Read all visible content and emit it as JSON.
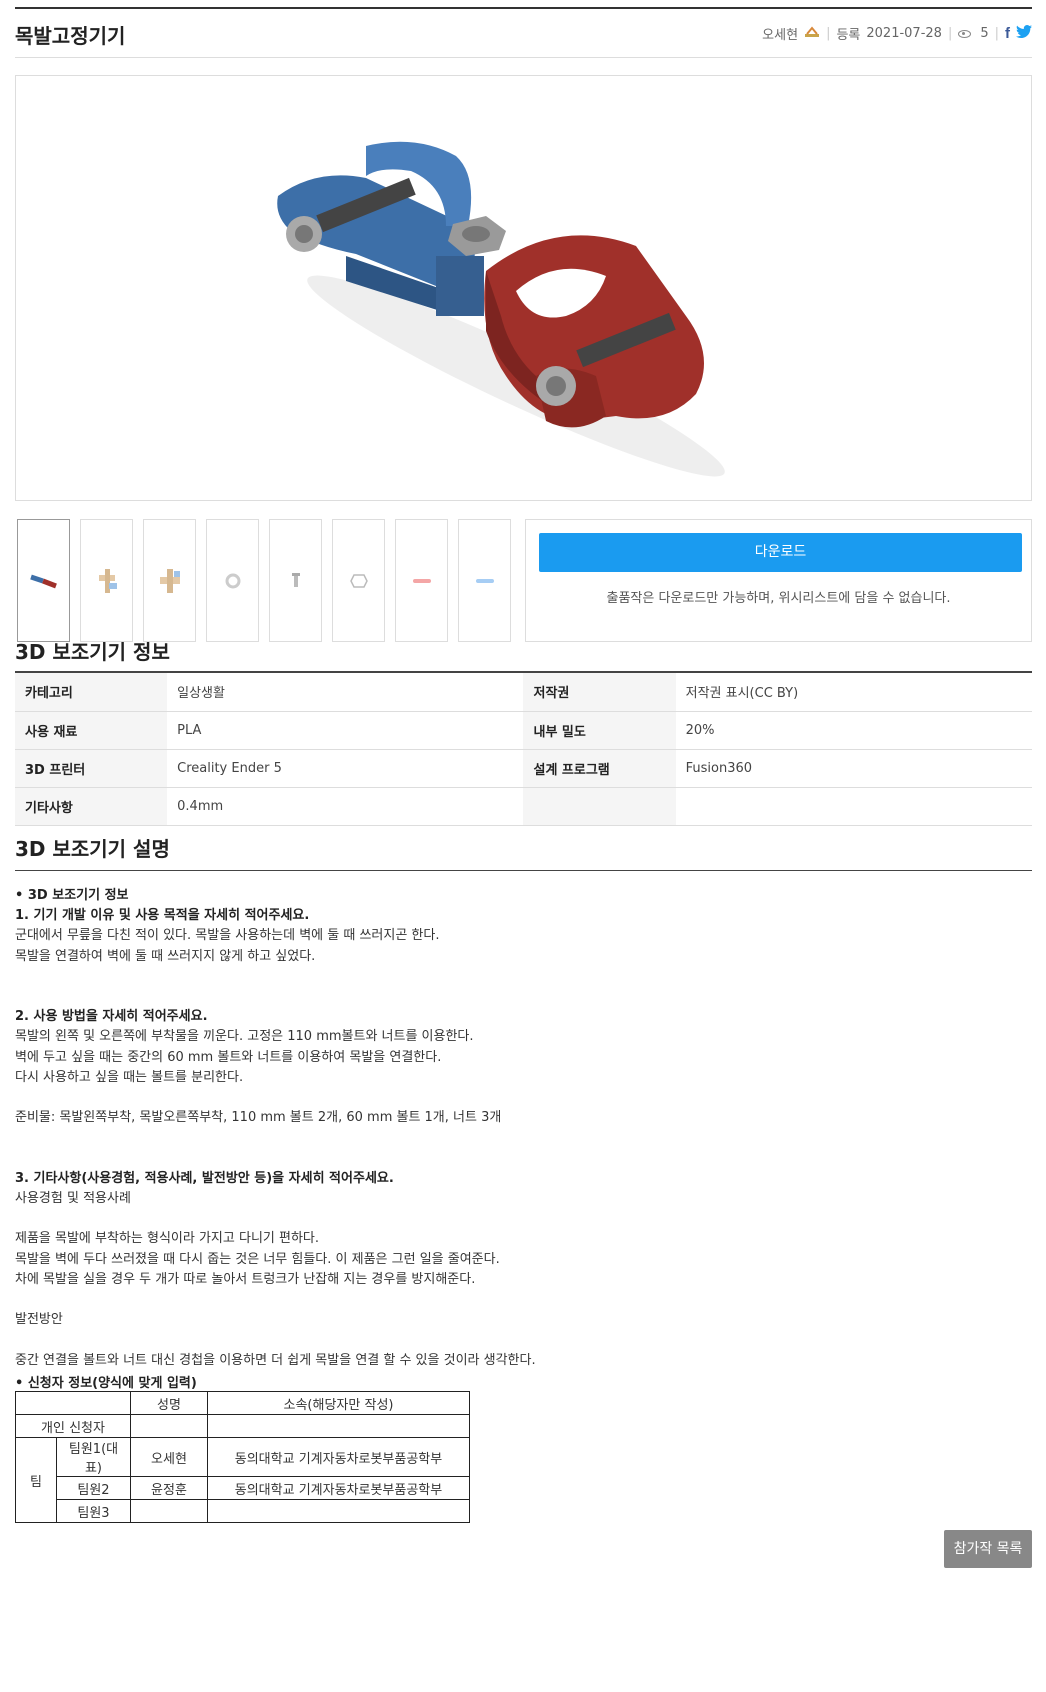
{
  "header": {
    "title": "목발고정기기",
    "author": "오세현",
    "registered_label": "등록",
    "registered_date": "2021-07-28",
    "views": "5",
    "facebook": "f"
  },
  "thumbnails": [
    "model-full",
    "model-part-a",
    "model-part-b",
    "washer",
    "bolt",
    "nut",
    "pink-part",
    "blue-part"
  ],
  "download": {
    "button_label": "다운로드",
    "note": "출품작은 다운로드만 가능하며, 위시리스트에 담을 수 없습니다."
  },
  "info": {
    "title": "3D 보조기기 정보",
    "rows": [
      {
        "k1": "카테고리",
        "v1": "일상생활",
        "k2": "저작권",
        "v2": "저작권 표시(CC BY)"
      },
      {
        "k1": "사용 재료",
        "v1": "PLA",
        "k2": "내부 밀도",
        "v2": "20%"
      },
      {
        "k1": "3D 프린터",
        "v1": "Creality Ender 5",
        "k2": "설계 프로그램",
        "v2": "Fusion360"
      },
      {
        "k1": "기타사항",
        "v1": "0.4mm",
        "k2": "",
        "v2": ""
      }
    ]
  },
  "description": {
    "title": "3D 보조기기 설명",
    "lines": [
      {
        "t": "• 3D 보조기기 정보",
        "b": true
      },
      {
        "t": "1. 기기 개발 이유 및 사용 목적을 자세히 적어주세요.",
        "b": true
      },
      {
        "t": "군대에서 무릎을 다친 적이 있다. 목발을 사용하는데 벽에 둘 때 쓰러지곤 한다.",
        "b": false
      },
      {
        "t": "목발을 연결하여 벽에 둘 때 쓰러지지 않게 하고 싶었다.",
        "b": false
      },
      {
        "t": "",
        "b": false
      },
      {
        "t": "",
        "b": false
      },
      {
        "t": "2. 사용 방법을 자세히 적어주세요.",
        "b": true
      },
      {
        "t": "목발의 왼쪽 및 오른쪽에 부착물을 끼운다. 고정은 110 mm볼트와 너트를 이용한다.",
        "b": false
      },
      {
        "t": "벽에 두고 싶을 때는 중간의 60 mm 볼트와 너트를 이용하여 목발을 연결한다.",
        "b": false
      },
      {
        "t": "다시 사용하고 싶을 때는 볼트를 분리한다.",
        "b": false
      },
      {
        "t": "",
        "b": false
      },
      {
        "t": "준비물: 목발왼쪽부착, 목발오른쪽부착, 110 mm 볼트 2개, 60 mm 볼트 1개, 너트 3개",
        "b": false
      },
      {
        "t": "",
        "b": false
      },
      {
        "t": "",
        "b": false
      },
      {
        "t": "3. 기타사항(사용경험, 적용사례, 발전방안 등)을 자세히 적어주세요.",
        "b": true
      },
      {
        "t": "사용경험 및 적용사례",
        "b": false
      },
      {
        "t": "",
        "b": false
      },
      {
        "t": "제품을 목발에 부착하는 형식이라 가지고 다니기 편하다.",
        "b": false
      },
      {
        "t": "목발을 벽에 두다 쓰러졌을 때 다시 줍는 것은 너무 힘들다. 이 제품은 그런 일을 줄여준다.",
        "b": false
      },
      {
        "t": "차에 목발을 실을 경우 두 개가 따로 놀아서 트렁크가 난잡해 지는 경우를 방지해준다.",
        "b": false
      },
      {
        "t": "",
        "b": false
      },
      {
        "t": "발전방안",
        "b": false
      },
      {
        "t": "",
        "b": false
      },
      {
        "t": "중간 연결을 볼트와 너트 대신 경첩을 이용하면 더 쉽게 목발을 연결 할 수 있을 것이라 생각한다.",
        "b": false
      }
    ]
  },
  "applicant": {
    "title": "• 신청자 정보(양식에 맞게 입력)",
    "col_name": "성명",
    "col_affil": "소속(해당자만 작성)",
    "individual": "개인 신청자",
    "team": "팀",
    "members": [
      {
        "role": "팀원1(대표)",
        "name": "오세현",
        "affil": "동의대학교 기계자동차로봇부품공학부"
      },
      {
        "role": "팀원2",
        "name": "윤정훈",
        "affil": "동의대학교 기계자동차로봇부품공학부"
      },
      {
        "role": "팀원3",
        "name": "",
        "affil": ""
      }
    ]
  },
  "footer": {
    "list_button": "참가작 목록"
  },
  "colors": {
    "accent": "#1a9bf0",
    "blue_part": "#3d6fa8",
    "red_part": "#a0302a"
  }
}
